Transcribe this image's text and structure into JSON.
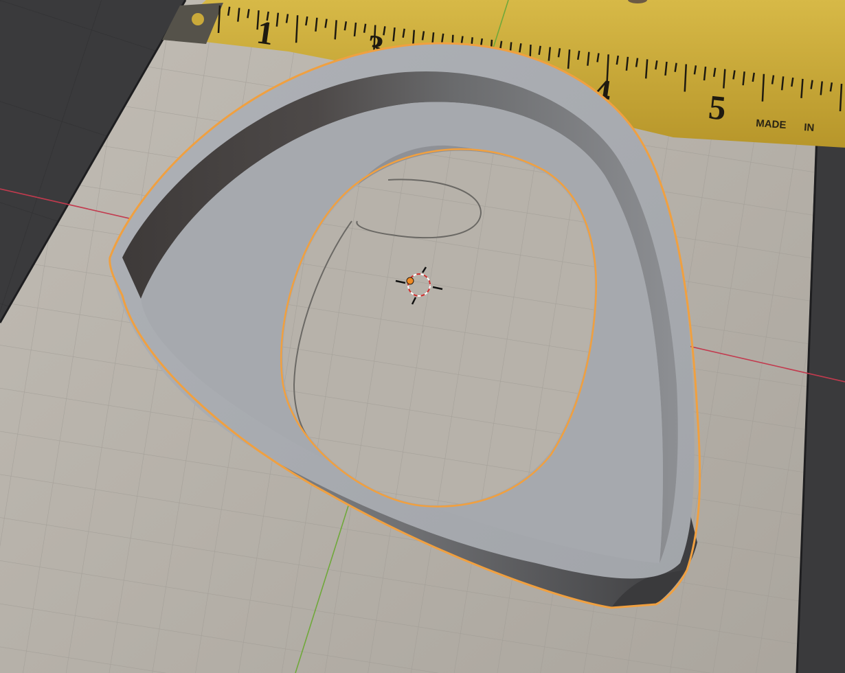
{
  "viewport": {
    "tape_numbers": [
      "1",
      "3",
      "4",
      "5"
    ],
    "tape_made_text": "MADE",
    "tape_in_text": "IN"
  },
  "colors": {
    "background": "#3a3a3c",
    "paper": "#b9b4ac",
    "tape": "#c9a93a",
    "selection_outline": "#f0a040",
    "x_axis": "#c23a4e",
    "y_axis": "#6fa83a",
    "mesh": "#a9adb2"
  },
  "icons": [
    "3d-cursor-icon",
    "object-origin-icon"
  ]
}
